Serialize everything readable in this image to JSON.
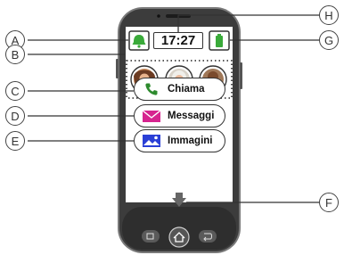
{
  "status_bar": {
    "time": "17:27"
  },
  "contacts": [
    "contact-1",
    "contact-2",
    "contact-3"
  ],
  "buttons": [
    {
      "label": "Chiama",
      "icon": "phone-icon",
      "color": "#2e8b2e"
    },
    {
      "label": "Messaggi",
      "icon": "envelope-icon",
      "color": "#d6248f"
    },
    {
      "label": "Immagini",
      "icon": "picture-icon",
      "color": "#2a3fd6"
    }
  ],
  "callouts": [
    "A",
    "B",
    "C",
    "D",
    "E",
    "F",
    "G",
    "H"
  ],
  "colors": {
    "bell": "#3aaa3a",
    "battery": "#3aaa3a",
    "phone_body": "#3a3a3a",
    "frame": "#6a6a6a"
  }
}
